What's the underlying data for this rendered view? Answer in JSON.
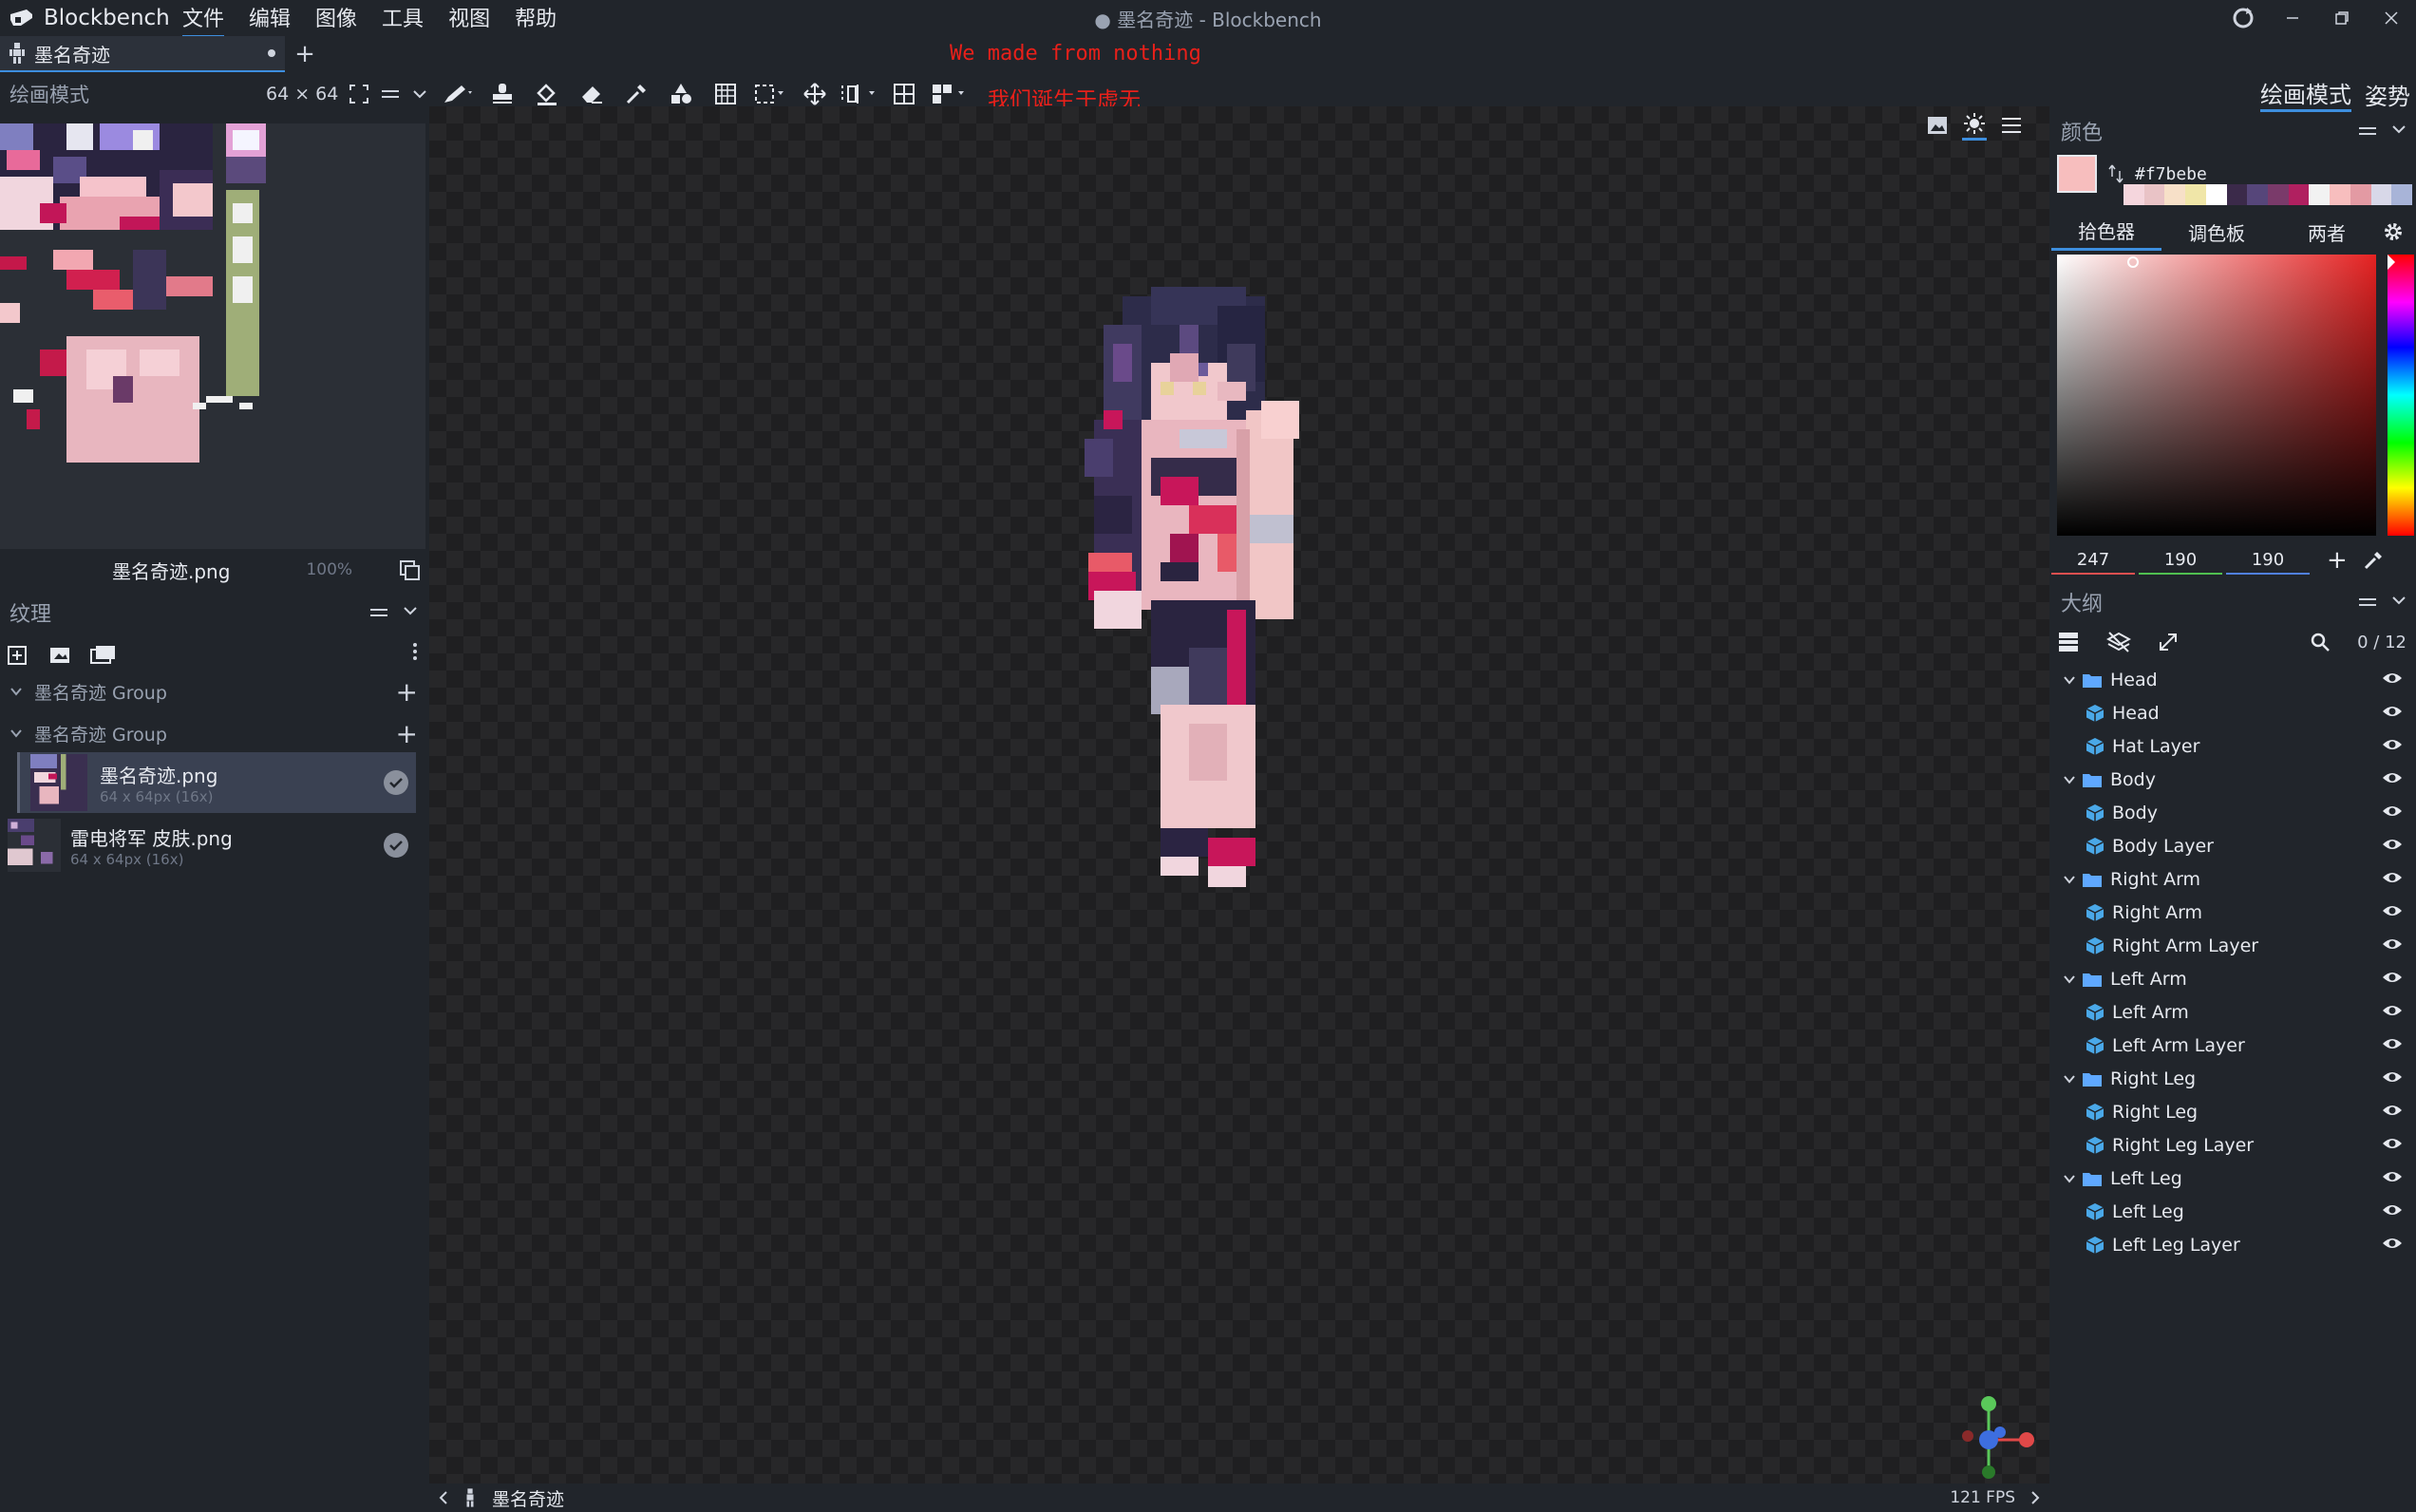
{
  "app": {
    "name": "Blockbench",
    "window_title": "● 墨名奇迹 - Blockbench",
    "menus": [
      "文件",
      "编辑",
      "图像",
      "工具",
      "视图",
      "帮助"
    ]
  },
  "tab": {
    "label": "墨名奇迹"
  },
  "overlay_text": {
    "line1": "We made from nothing",
    "line2": "我们诞生于虚无"
  },
  "uv_panel": {
    "title": "绘画模式",
    "size": "64 × 64",
    "file": "墨名奇迹.png",
    "zoom": "100%"
  },
  "modes": {
    "paint": "绘画模式",
    "pose": "姿势"
  },
  "textures": {
    "title": "纹理",
    "groups": [
      {
        "label": "墨名奇迹 Group"
      },
      {
        "label": "墨名奇迹 Group"
      }
    ],
    "items": [
      {
        "name": "墨名奇迹.png",
        "info": "64 x 64px (16x)",
        "selected": true
      },
      {
        "name": "雷电将军 皮肤.png",
        "info": "64 x 64px (16x)",
        "selected": false
      }
    ]
  },
  "color_panel": {
    "title": "颜色",
    "hex": "#f7bebe",
    "current_color": "#f7bebe",
    "tabs": [
      "拾色器",
      "调色板",
      "两者"
    ],
    "active_tab": "拾色器",
    "rgb": {
      "r": "247",
      "g": "190",
      "b": "190"
    },
    "palette_colors": [
      "#f5d6dd",
      "#e9c3c6",
      "#f7e0c8",
      "#f0e6a8",
      "#ffffff",
      "#3b2a4a",
      "#56467a",
      "#7a3a6a",
      "#b02060",
      "#f2f2f2",
      "#f7bebe",
      "#e39aa3",
      "#d8d8e8",
      "#a8b4d8"
    ]
  },
  "outliner": {
    "title": "大纲",
    "count": "0 / 12",
    "groups": [
      {
        "name": "Head",
        "children": [
          "Head",
          "Hat Layer"
        ]
      },
      {
        "name": "Body",
        "children": [
          "Body",
          "Body Layer"
        ]
      },
      {
        "name": "Right Arm",
        "children": [
          "Right Arm",
          "Right Arm Layer"
        ]
      },
      {
        "name": "Left Arm",
        "children": [
          "Left Arm",
          "Left Arm Layer"
        ]
      },
      {
        "name": "Right Leg",
        "children": [
          "Right Leg",
          "Right Leg Layer"
        ]
      },
      {
        "name": "Left Leg",
        "children": [
          "Left Leg",
          "Left Leg Layer"
        ]
      }
    ]
  },
  "status": {
    "project": "墨名奇迹",
    "fps": "121 FPS"
  },
  "colors": {
    "accent": "#3d8ede",
    "background": "#21252b",
    "viewport": "#1f1f21",
    "red_text": "#e8201a",
    "folder": "#5fa8ff",
    "cube": "#4aa8e8"
  }
}
